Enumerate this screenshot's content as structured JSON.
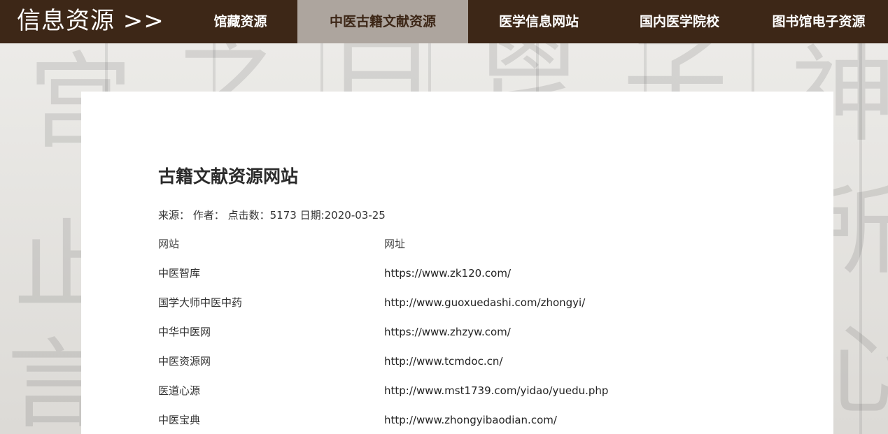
{
  "nav": {
    "brand": "信息资源 >>",
    "items": [
      {
        "label": "馆藏资源",
        "active": false
      },
      {
        "label": "中医古籍文献资源",
        "active": true
      },
      {
        "label": "医学信息网站",
        "active": false
      },
      {
        "label": "国内医学院校",
        "active": false
      },
      {
        "label": "图书馆电子资源",
        "active": false
      }
    ]
  },
  "article": {
    "title": "古籍文献资源网站",
    "meta": {
      "source_label": "来源：",
      "author_label": "作者：",
      "clicks_label": "点击数：",
      "clicks": "5173",
      "date_label": "日期:",
      "date": "2020-03-25"
    },
    "table": {
      "headers": [
        "网站",
        "网址"
      ],
      "rows": [
        {
          "name": "中医智库",
          "url": "https://www.zk120.com/"
        },
        {
          "name": "国学大师中医中药",
          "url": "http://www.guoxuedashi.com/zhongyi/"
        },
        {
          "name": "中华中医网",
          "url": "https://www.zhzyw.com/"
        },
        {
          "name": "中医资源网",
          "url": "http://www.tcmdoc.cn/"
        },
        {
          "name": "医道心源",
          "url": "http://www.mst1739.com/yidao/yuedu.php"
        },
        {
          "name": "中医宝典",
          "url": "http://www.zhongyibaodian.com/"
        }
      ]
    }
  }
}
